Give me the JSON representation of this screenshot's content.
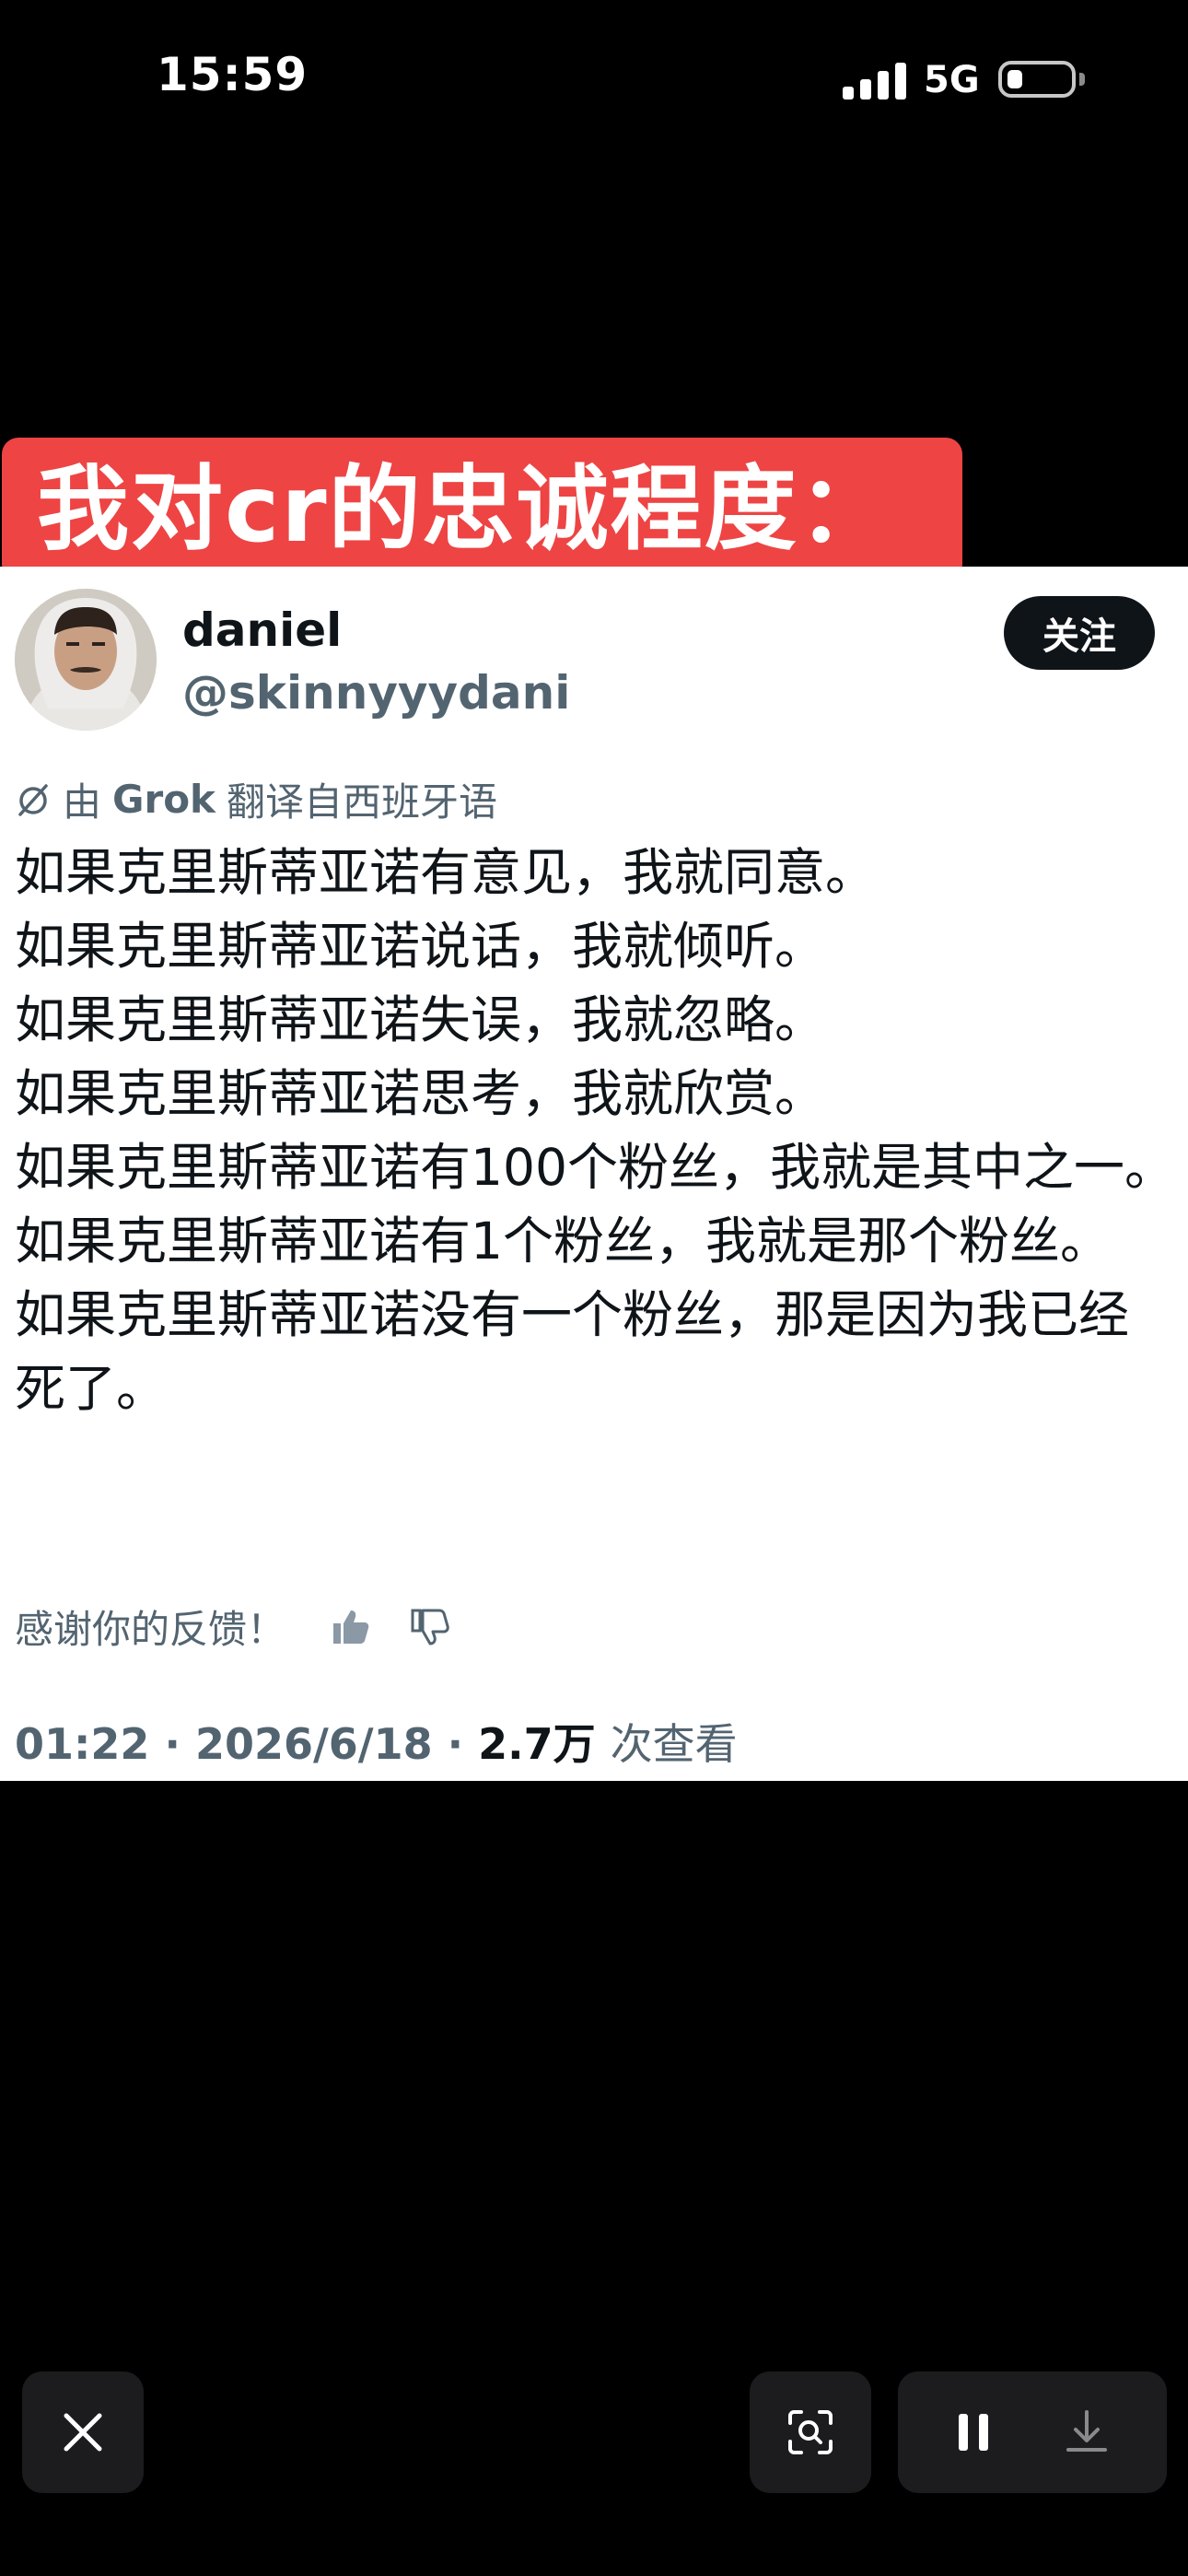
{
  "status_bar": {
    "time": "15:59",
    "network": "5G"
  },
  "banner": {
    "text": "我对cr的忠诚程度："
  },
  "tweet": {
    "display_name": "daniel",
    "handle": "@skinnyyydani",
    "follow_label": "关注",
    "translation_note": {
      "prefix": "由",
      "engine": "Grok",
      "suffix": "翻译自西班牙语"
    },
    "lines": [
      "如果克里斯蒂亚诺有意见，我就同意。",
      "如果克里斯蒂亚诺说话，我就倾听。",
      "如果克里斯蒂亚诺失误，我就忽略。",
      "如果克里斯蒂亚诺思考，我就欣赏。",
      "如果克里斯蒂亚诺有100个粉丝，我就是其中之一。",
      "如果克里斯蒂亚诺有1个粉丝，我就是那个粉丝。",
      "如果克里斯蒂亚诺没有一个粉丝，那是因为我已经死了。"
    ],
    "feedback_label": "感谢你的反馈！",
    "time": "01:22",
    "date": "2026/6/18",
    "views_count": "2.7万",
    "views_label": "次查看"
  },
  "icons": {
    "close": "close-icon",
    "scan": "image-search-icon",
    "pause": "pause-icon",
    "download": "download-icon",
    "like": "thumbs-up-icon",
    "dislike": "thumbs-down-icon",
    "translate": "grok-icon"
  }
}
